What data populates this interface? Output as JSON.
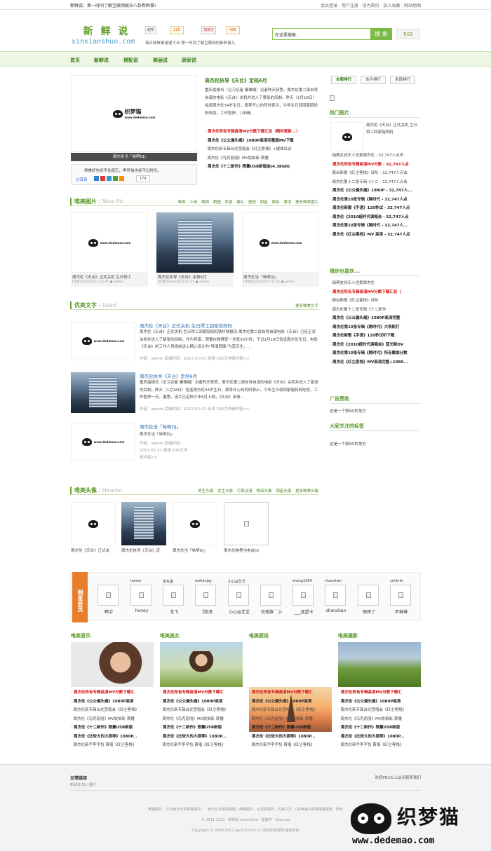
{
  "topbar": {
    "notice": "新鲜说：第一时间了解互联网娱乐八卦新鲜事!",
    "links": "会员登录 · 用户注册 · 设为首页 · 加入收藏 · 网站地图"
  },
  "logo": {
    "cn": "新 鲜 说",
    "en": "xinxianshuo.com"
  },
  "header": {
    "tencent": "收听",
    "tencent_count": "118",
    "sina": "加关注",
    "sina_count": "486",
    "slogan": "每日新鲜事速递平台 第一时间了解互联网的新鲜事儿"
  },
  "search": {
    "placeholder": "在这里搜索...",
    "button": "搜 索",
    "rss": "RSS"
  },
  "nav": {
    "items": [
      "首页",
      "新鲜说",
      "搭配说",
      "美丽说",
      "居家说"
    ]
  },
  "feature": {
    "slide_caption": "周杰伦当「咏明DJ」",
    "title": "周杰伦执导《天台》定档6月",
    "summary": "重庆晨报讯（见习记者 秦雅娟）记者昨天获悉，周杰伦第二部自导自演的电影《天台》关机并进入了紧张的后制。昨天（1月18日）恰逢周杰伦34岁生日，周导开心的同时表示，今年生日就回家陪妈妈吃饭。工作暂停... [详细]",
    "links": [
      "周杰伦所有专辑高清MV分数下载汇总（随时更新...）",
      "周杰伦《公公偏头痛》1080P高清完整版MV下载",
      "周杰伦新专辑台北签唱会《红尘客栈》+媒体采访",
      "周杰伦《乌克丽丽》MV饭拍新 首播",
      "周杰伦《十二新作》限量USB新版曲[4.38GB]"
    ],
    "share_text": "再美好也经不住遗忘，再可怕也经不过时光。",
    "share": "分享到",
    "share_count": "179"
  },
  "pics": {
    "title": "唯美图片",
    "sub": " / New Pic",
    "tags": "唯美 小清 萌物 萌图 风景 摄礼 壁纸 明星 情侣 意境 更多唯美图片",
    "items": [
      {
        "cap": "周杰伦《天台》正式关机 生日得工",
        "meta": "[作者][date]2013-02-01 ● admin"
      },
      {
        "cap": "周杰伦执导《天台》定档6月",
        "meta": "[作者][date]2013-02-01 ● admin"
      },
      {
        "cap": "周杰伦当「咏明DJ」",
        "meta": "[作者][date]2013-01-31 ● admin"
      }
    ]
  },
  "text": {
    "title": "优美文字",
    "sub": " / Read",
    "more": "更多唯美文字",
    "items": [
      {
        "t": "周杰伦《天台》正式关机 生日得工回家陪妈妈",
        "d": "周杰伦《天台》正式关机 生日得工回家陪妈妈铁杯快报讯 周杰伦第二部自导自演电影《天台》已经正式关机并进入了紧张的后制。作为导演，周董在微博宣一全就30小时，于过1月18日恰逢周杰伦生日，电影《天台》的工作人员提前送上精心设计的\"导演假面\"为其庆生，...",
        "m": "作者：admin 后端时间：2013-02-01 阅读 536次详细内容>>"
      },
      {
        "t": "周杰伦执导《天台》定档6月",
        "d": "重庆晨报讯（见习记者 秦雅娟）记者昨天获悉，周杰伦第二部自导自演的电影《天台》关机并进入了紧张的后制。昨天（1月18日）恰逢周杰伦34岁生日，周导开心的同时表示，今年生日就回家陪妈妈吃饭，工作暂停一天。据悉，该片已定档今年6月上映，《天台》亲青...",
        "m": "作者：admin 后端时间：2013-02-01 阅读 536次详细内容>>"
      },
      {
        "t": "周杰伦当「咏明DJ」",
        "d": "周杰伦当「咏明DJ」",
        "m": "作者：admin 后端时间：2013-01-31 阅读 536次详细内容>>"
      }
    ]
  },
  "avatar": {
    "title": "唯美头像",
    "sub": " / Header",
    "tags": "男生头像 女生头像 可爱动漫 情侣头像 明星头像 更多唯美头像",
    "items": [
      "周杰伦《天台》正式关",
      "周杰伦执导《天台》定",
      "周杰伦当「咏明DJ」",
      "周杰伦跨界当电台DJ"
    ]
  },
  "members": {
    "label": "明星会员",
    "items": [
      {
        "n": "",
        "nm": "韩宇"
      },
      {
        "n": "honey",
        "nm": "honey"
      },
      {
        "n": "京东富",
        "nm": "龙飞"
      },
      {
        "n": "wohenjay",
        "nm": "【我浪"
      },
      {
        "n": "小心@艺艺",
        "nm": "小心@艺艺"
      },
      {
        "n": "",
        "nm": "完美旗＾小"
      },
      {
        "n": "sheng1004",
        "nm": "___迷望卡"
      },
      {
        "n": "shanshan",
        "nm": "shanshan"
      },
      {
        "n": "",
        "nm": "雨停了"
      },
      {
        "n": "yinlinlin",
        "nm": "尹琳琳"
      }
    ]
  },
  "cols": [
    {
      "h": "唯美音乐"
    },
    {
      "h": "唯美美女"
    },
    {
      "h": "唯美壁纸"
    },
    {
      "h": "唯美摄影"
    }
  ],
  "col_links": [
    "周杰伦所有专辑高清MV分数下载汇",
    "周杰伦《公公偏头痛》1080P高清",
    "周杰伦新专辑台北签唱会《红尘客栈》",
    "周杰伦《乌克丽丽》MV饭拍新 首播",
    "周杰伦《十二新作》限量USB新版",
    "周杰伦《比较大的大提琴》1080P...",
    "周杰伦牵手李字恰 首唱《红尘客栈》"
  ],
  "sidebar": {
    "tabs": [
      "本周排行",
      "本月排行",
      "全部排行"
    ],
    "hot_title": "热门图片",
    "hot_pic": "周杰伦《天台》正式关机 生日得工回家陪妈妈",
    "rank": [
      "瑞典女孩乐人也爱周杰伦 - 32,747人点击",
      "周杰伦所有专辑高清MV分数 - 32,747人点",
      "疑似新歌《红尘客栈》试听 - 32,747人点击",
      "周杰伦第十二张专辑《十二 - 32,747人点击",
      "周杰伦《公公偏头痛》1080P - 32,747人...",
      "周杰伦第10张专辑《跨时代 - 32,747人点",
      "周杰伦新歌《手语》120秒试 - 32,747人点",
      "周杰伦《2010超时代演唱会 - 32,747人点",
      "周杰伦第10张专辑《跨时代 - 32,747人...",
      "周杰伦《红尘客栈》MV 高清 - 32,747人点"
    ],
    "like_title": "猜你也喜欢...",
    "like": [
      "瑞典女孩乐人也爱周杰伦",
      "周杰伦所有专辑高清MV分数下载汇总（",
      "疑似新歌《红尘客栈》试听",
      "周杰伦第十二张专辑《十二新作",
      "周杰伦《公公偏头痛》1080P高清完整",
      "周杰伦第10张专辑《跨时代》大杨斯打",
      "周杰伦新歌《手语》120秒试听下载",
      "周杰伦《2010超时代演唱会》蓝光新DV",
      "周杰伦第10张专辑《跨时代》所有歌曲分数",
      "周杰伦《红尘客栈》MV高清完整+1080..."
    ],
    "ad_title": "广告赞助",
    "ad_text": "这是一个很AD的地方",
    "tags_title": "大家关注的标签",
    "tags_text": "这是一个很AD的地方"
  },
  "footer": {
    "links_title": "友情链接",
    "contact": "欢迎PR2以上站点联系我们",
    "friends": "新鲜说  加入我们",
    "line1": "唯美图片，只为每日分享唯美图片！ · 每日分享最新美图，唯美图片，小清新图片，优美文字，QQ唯美头像等唯美壁纸，所有",
    "line2": "© 2011-2012 · 新鲜说 moketlove · 备案中 · Sitemap",
    "line3": "Copyright © 2009-2012 Jay520.Com.Cn 周杰伦新歌网 版权所有"
  },
  "watermark": {
    "cn": "织梦猫",
    "url": "www.dedemao.com"
  }
}
